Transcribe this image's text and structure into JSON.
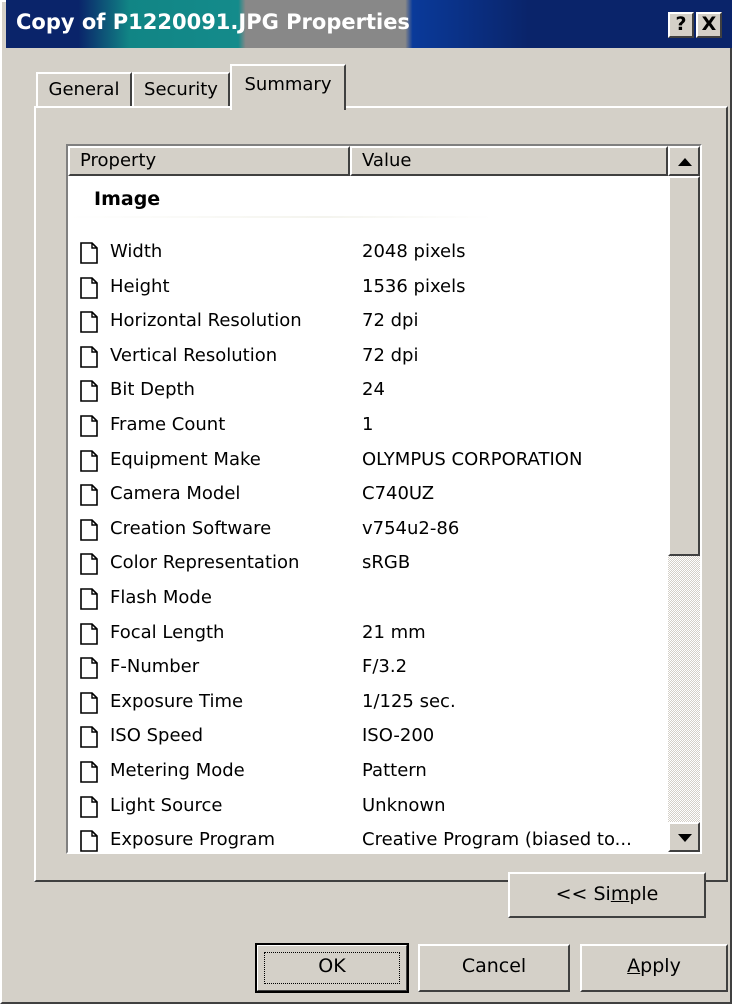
{
  "window": {
    "title": "Copy of P1220091.JPG Properties",
    "help_label": "?",
    "close_label": "X"
  },
  "tabs": [
    {
      "label": "General",
      "selected": false
    },
    {
      "label": "Security",
      "selected": false
    },
    {
      "label": "Summary",
      "selected": true
    }
  ],
  "list": {
    "columns": [
      "Property",
      "Value"
    ],
    "group": "Image",
    "rows": [
      {
        "property": "Width",
        "value": "2048 pixels"
      },
      {
        "property": "Height",
        "value": "1536 pixels"
      },
      {
        "property": "Horizontal Resolution",
        "value": "72 dpi"
      },
      {
        "property": "Vertical Resolution",
        "value": "72 dpi"
      },
      {
        "property": "Bit Depth",
        "value": "24"
      },
      {
        "property": "Frame Count",
        "value": "1"
      },
      {
        "property": "Equipment Make",
        "value": "OLYMPUS CORPORATION"
      },
      {
        "property": "Camera Model",
        "value": "C740UZ"
      },
      {
        "property": "Creation Software",
        "value": "v754u2-86"
      },
      {
        "property": "Color Representation",
        "value": "sRGB"
      },
      {
        "property": "Flash Mode",
        "value": ""
      },
      {
        "property": "Focal Length",
        "value": "21 mm"
      },
      {
        "property": "F-Number",
        "value": "F/3.2"
      },
      {
        "property": "Exposure Time",
        "value": "1/125 sec."
      },
      {
        "property": "ISO Speed",
        "value": "ISO-200"
      },
      {
        "property": "Metering Mode",
        "value": "Pattern"
      },
      {
        "property": "Light Source",
        "value": "Unknown"
      },
      {
        "property": "Exposure Program",
        "value": "Creative Program (biased to..."
      }
    ],
    "icon": "document-icon"
  },
  "buttons": {
    "simple": {
      "pre": "<< Si",
      "mnemonic": "m",
      "post": "ple"
    },
    "ok": "OK",
    "cancel": "Cancel",
    "apply": {
      "mnemonic": "A",
      "post": "pply"
    }
  },
  "colors": {
    "dialog_face": "#d4d0c8",
    "title_active": "#0a246a",
    "list_background": "#ffffff"
  }
}
